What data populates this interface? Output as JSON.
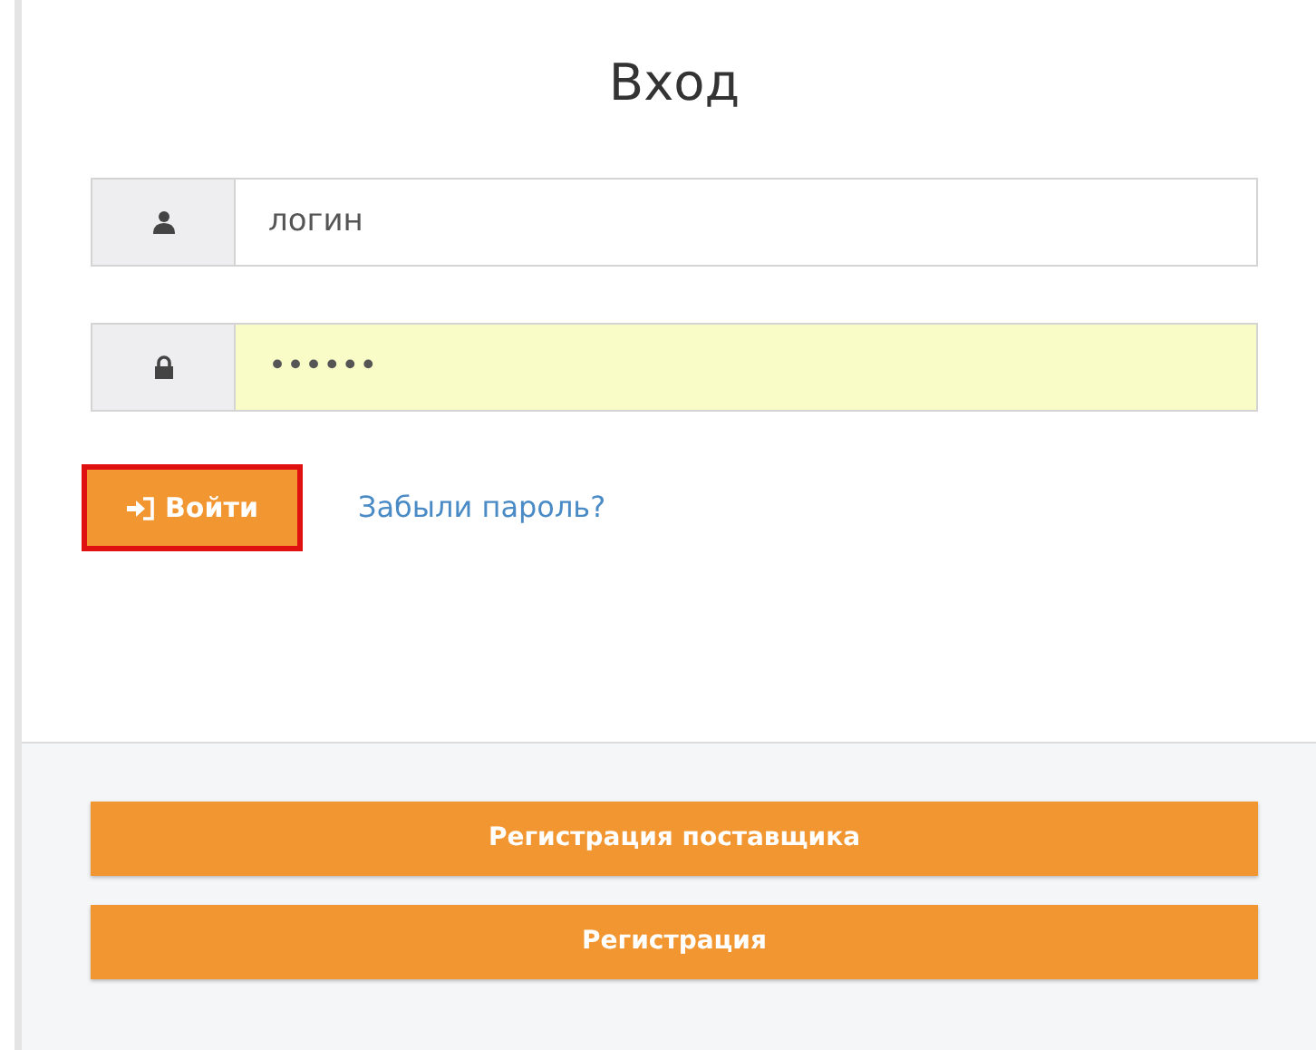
{
  "title": "Вход",
  "fields": [
    {
      "kind": "login",
      "value": "логин",
      "autofilled": false
    },
    {
      "kind": "password",
      "value": "••••••",
      "autofilled": true
    }
  ],
  "login_button": {
    "label": "Войти",
    "focused": true
  },
  "forgot_link": "Забыли пароль?",
  "footer_buttons": [
    "Регистрация поставщика",
    "Регистрация"
  ]
}
